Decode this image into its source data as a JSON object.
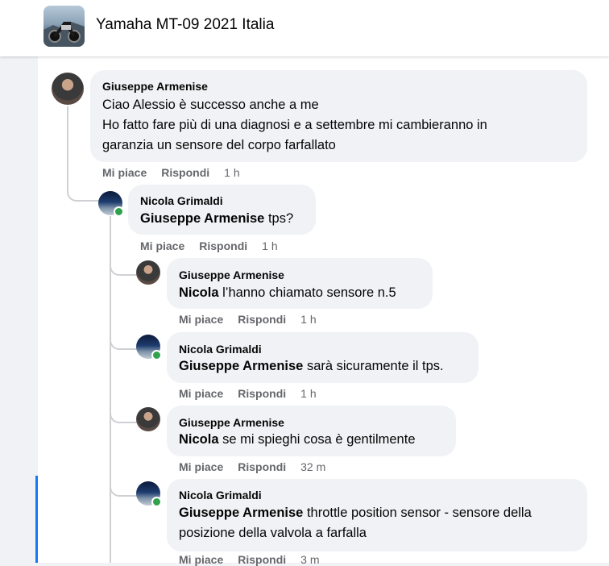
{
  "group": {
    "title": "Yamaha MT-09 2021 Italia",
    "thumb_icon": "motorcycle-photo"
  },
  "actions": {
    "like": "Mi piace",
    "reply": "Rispondi"
  },
  "comments": [
    {
      "author": "Giuseppe Armenise",
      "mention": "",
      "lines": [
        "Ciao Alessio è successo anche a me",
        "Ho fatto fare più di una diagnosi e a settembre mi cambieranno in",
        "garanzia un sensore del corpo farfallato"
      ],
      "time": "1 h"
    },
    {
      "author": "Nicola Grimaldi",
      "mention": "Giuseppe Armenise",
      "text": " tps?",
      "time": "1 h",
      "online": true
    },
    {
      "author": "Giuseppe Armenise",
      "mention": "Nicola",
      "text": " l’hanno chiamato sensore n.5",
      "time": "1 h"
    },
    {
      "author": "Nicola Grimaldi",
      "mention": "Giuseppe Armenise",
      "text": " sarà sicuramente il tps.",
      "time": "1 h",
      "online": true
    },
    {
      "author": "Giuseppe Armenise",
      "mention": "Nicola",
      "text": " se mi spieghi cosa è gentilmente",
      "time": "32 m"
    },
    {
      "author": "Nicola Grimaldi",
      "mention": "Giuseppe Armenise",
      "text": " throttle position sensor - sensore della",
      "text2": "posizione della valvola a farfalla",
      "time": "3 m",
      "online": true
    }
  ],
  "colors": {
    "accent": "#1877f2",
    "online": "#31a24c",
    "bubble": "#f0f2f5",
    "meta": "#65676b"
  }
}
